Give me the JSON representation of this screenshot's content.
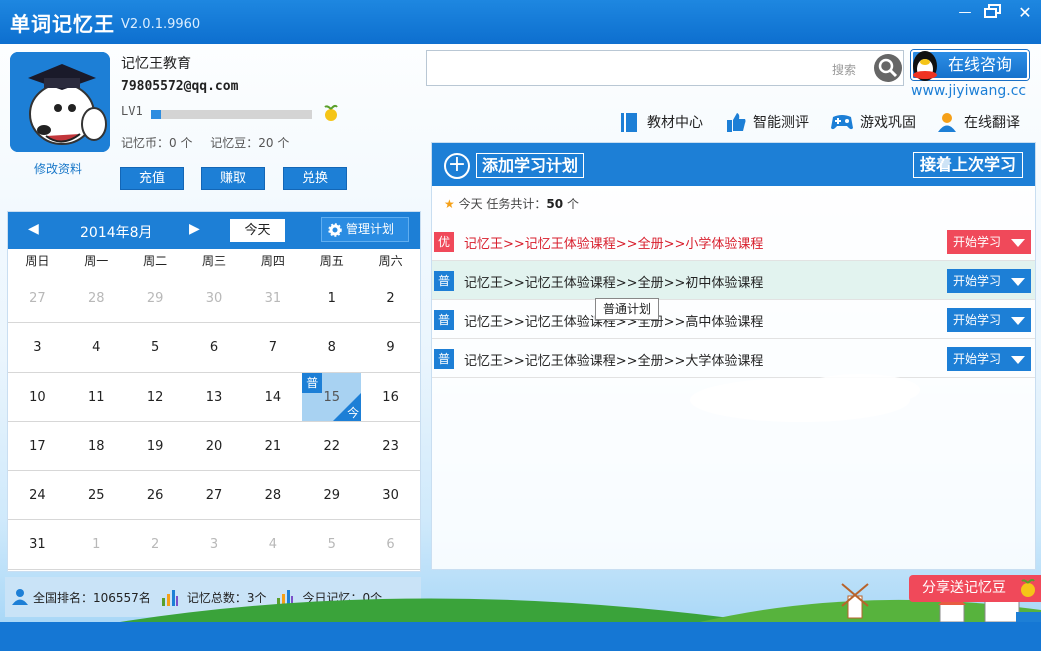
{
  "app": {
    "title": "单词记忆王",
    "version": "V2.0.1.9960"
  },
  "window_controls": [
    "minimize-icon",
    "maximize-icon",
    "close-icon"
  ],
  "profile": {
    "name": "记忆王教育",
    "email": "79805572@qq.com",
    "level": "LV1",
    "level_progress": 0.06,
    "coins_label": "记忆币：0 个",
    "beans_label": "记忆豆：20 个",
    "edit_label": "修改资料",
    "buttons": [
      "充值",
      "赚取",
      "兑换"
    ]
  },
  "calendar": {
    "month": "2014年8月",
    "today_label": "今天",
    "manage_label": "管理计划",
    "weekdays": [
      "周日",
      "周一",
      "周二",
      "周三",
      "周四",
      "周五",
      "周六"
    ],
    "days": [
      "27",
      "28",
      "29",
      "30",
      "31",
      "1",
      "2",
      "3",
      "4",
      "5",
      "6",
      "7",
      "8",
      "9",
      "10",
      "11",
      "12",
      "13",
      "14",
      "15",
      "16",
      "17",
      "18",
      "19",
      "20",
      "21",
      "22",
      "23",
      "24",
      "25",
      "26",
      "27",
      "28",
      "29",
      "30",
      "31",
      "1",
      "2",
      "3",
      "4",
      "5",
      "6"
    ],
    "muted_indices": [
      0,
      1,
      2,
      3,
      4,
      36,
      37,
      38,
      39,
      40,
      41
    ],
    "today_index": 19,
    "today_tag": "普",
    "today_corner": "今"
  },
  "stats": {
    "rank": "全国排名：106557名",
    "total": "记忆总数：3个",
    "today": "今日记忆：0个"
  },
  "search": {
    "value": "",
    "hint": "搜索"
  },
  "consult": {
    "label": "在线咨询",
    "url": "www.jiyiwang.cc"
  },
  "nav": [
    "教材中心",
    "智能测评",
    "游戏巩固",
    "在线翻译"
  ],
  "plans": {
    "add_label": "添加学习计划",
    "resume_label": "接着上次学习",
    "summary_prefix": "今天  任务共计：",
    "summary_count": "50",
    "summary_suffix": " 个",
    "start_label": "开始学习",
    "rows": [
      {
        "badge": "优",
        "text": "记忆王>>记忆王体验课程>>全册>>小学体验课程"
      },
      {
        "badge": "普",
        "text": "记忆王>>记忆王体验课程>>全册>>初中体验课程"
      },
      {
        "badge": "普",
        "text": "记忆王>>记忆王体验课程>>全册>>高中体验课程"
      },
      {
        "badge": "普",
        "text": "记忆王>>记忆王体验课程>>全册>>大学体验课程"
      }
    ],
    "tooltip": "普通计划"
  },
  "share_label": "分享送记忆豆",
  "colors": {
    "primary": "#1d7fd6",
    "priority": "#f0495a",
    "today_cell": "#a8d2f2"
  }
}
